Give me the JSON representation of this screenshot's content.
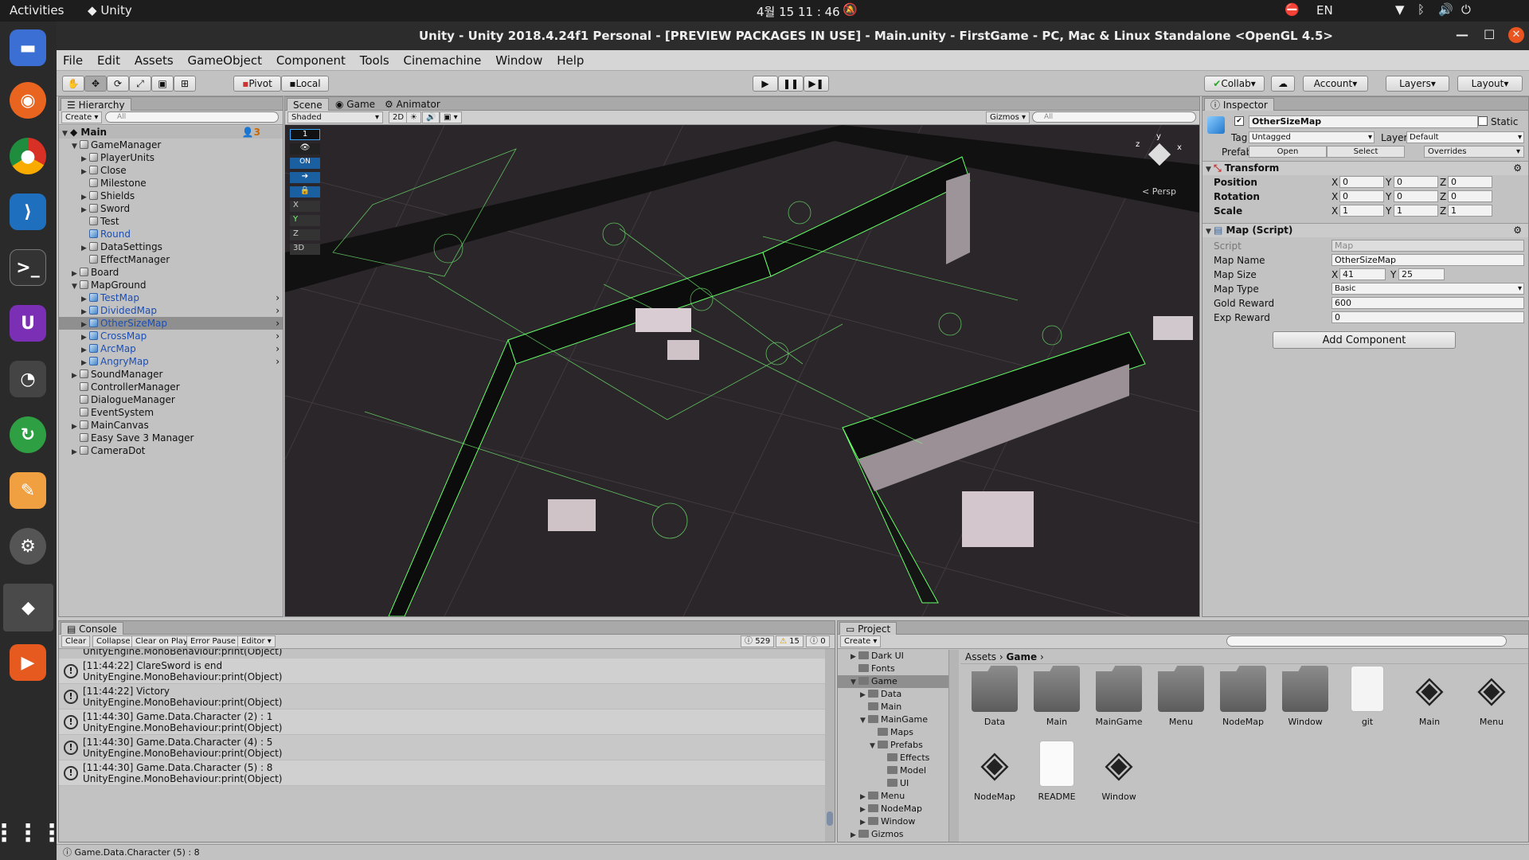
{
  "os": {
    "activities": "Activities",
    "app": "Unity",
    "clock": "4월 15  11 : 46",
    "lang": "EN"
  },
  "window": {
    "title": "Unity - Unity 2018.4.24f1 Personal - [PREVIEW PACKAGES IN USE] - Main.unity - FirstGame - PC, Mac & Linux Standalone <OpenGL 4.5>"
  },
  "menu": [
    "File",
    "Edit",
    "Assets",
    "GameObject",
    "Component",
    "Tools",
    "Cinemachine",
    "Window",
    "Help"
  ],
  "toolbar": {
    "pivot": "Pivot",
    "local": "Local",
    "collab": "Collab",
    "account": "Account",
    "layers": "Layers",
    "layout": "Layout"
  },
  "hierarchy": {
    "tab": "Hierarchy",
    "create": "Create",
    "search": "All",
    "scene": "Main",
    "badge": "3",
    "rows": [
      {
        "label": "GameManager",
        "indent": 1,
        "arrow": "▼",
        "blue": false
      },
      {
        "label": "PlayerUnits",
        "indent": 2,
        "arrow": "▶",
        "blue": false
      },
      {
        "label": "Close",
        "indent": 2,
        "arrow": "▶",
        "blue": false
      },
      {
        "label": "Milestone",
        "indent": 2,
        "arrow": "",
        "blue": false
      },
      {
        "label": "Shields",
        "indent": 2,
        "arrow": "▶",
        "blue": false
      },
      {
        "label": "Sword",
        "indent": 2,
        "arrow": "▶",
        "blue": false
      },
      {
        "label": "Test",
        "indent": 2,
        "arrow": "",
        "blue": false
      },
      {
        "label": "Round",
        "indent": 2,
        "arrow": "",
        "blue": true
      },
      {
        "label": "DataSettings",
        "indent": 2,
        "arrow": "▶",
        "blue": false
      },
      {
        "label": "EffectManager",
        "indent": 2,
        "arrow": "",
        "blue": false
      },
      {
        "label": "Board",
        "indent": 1,
        "arrow": "▶",
        "blue": false
      },
      {
        "label": "MapGround",
        "indent": 1,
        "arrow": "▼",
        "blue": false
      },
      {
        "label": "TestMap",
        "indent": 2,
        "arrow": "▶",
        "blue": true
      },
      {
        "label": "DividedMap",
        "indent": 2,
        "arrow": "▶",
        "blue": true
      },
      {
        "label": "OtherSizeMap",
        "indent": 2,
        "arrow": "▶",
        "blue": true,
        "selected": true
      },
      {
        "label": "CrossMap",
        "indent": 2,
        "arrow": "▶",
        "blue": true
      },
      {
        "label": "ArcMap",
        "indent": 2,
        "arrow": "▶",
        "blue": true
      },
      {
        "label": "AngryMap",
        "indent": 2,
        "arrow": "▶",
        "blue": true
      },
      {
        "label": "SoundManager",
        "indent": 1,
        "arrow": "▶",
        "blue": false
      },
      {
        "label": "ControllerManager",
        "indent": 1,
        "arrow": "",
        "blue": false
      },
      {
        "label": "DialogueManager",
        "indent": 1,
        "arrow": "",
        "blue": false
      },
      {
        "label": "EventSystem",
        "indent": 1,
        "arrow": "",
        "blue": false
      },
      {
        "label": "MainCanvas",
        "indent": 1,
        "arrow": "▶",
        "blue": false
      },
      {
        "label": "Easy Save 3 Manager",
        "indent": 1,
        "arrow": "",
        "blue": false
      },
      {
        "label": "CameraDot",
        "indent": 1,
        "arrow": "▶",
        "blue": false
      }
    ]
  },
  "scene": {
    "tabs": [
      "Scene",
      "Game",
      "Animator"
    ],
    "shading": "Shaded",
    "mode2d": "2D",
    "gizmos": "Gizmos",
    "search": "All",
    "persp": "< Persp",
    "badge1": "1",
    "on": "ON",
    "axes": [
      "X",
      "Y",
      "Z"
    ],
    "mode3d": "3D"
  },
  "inspector": {
    "tab": "Inspector",
    "name": "OtherSizeMap",
    "static": "Static",
    "tag_label": "Tag",
    "tag": "Untagged",
    "layer_label": "Layer",
    "layer": "Default",
    "prefab_label": "Prefab",
    "open": "Open",
    "select": "Select",
    "overrides": "Overrides",
    "transform": {
      "title": "Transform",
      "rows": [
        {
          "label": "Position",
          "x": "0",
          "y": "0",
          "z": "0"
        },
        {
          "label": "Rotation",
          "x": "0",
          "y": "0",
          "z": "0"
        },
        {
          "label": "Scale",
          "x": "1",
          "y": "1",
          "z": "1"
        }
      ]
    },
    "script": {
      "title": "Map (Script)",
      "script_label": "Script",
      "script": "Map",
      "map_name_label": "Map Name",
      "map_name": "OtherSizeMap",
      "map_size_label": "Map Size",
      "size_x": "41",
      "size_y": "25",
      "map_type_label": "Map Type",
      "map_type": "Basic",
      "gold_label": "Gold Reward",
      "gold": "600",
      "exp_label": "Exp Reward",
      "exp": "0"
    },
    "add_component": "Add Component"
  },
  "console": {
    "tab": "Console",
    "buttons": [
      "Clear",
      "Collapse",
      "Clear on Play",
      "Error Pause",
      "Editor"
    ],
    "count_info": "529",
    "count_warn": "15",
    "count_err": "0",
    "partial": "UnityEngine.MonoBehaviour:print(Object)",
    "entries": [
      {
        "msg": "[11:44:22] ClareSword is end",
        "src": "UnityEngine.MonoBehaviour:print(Object)"
      },
      {
        "msg": "[11:44:22] Victory",
        "src": "UnityEngine.MonoBehaviour:print(Object)"
      },
      {
        "msg": "[11:44:30] Game.Data.Character (2) : 1",
        "src": "UnityEngine.MonoBehaviour:print(Object)"
      },
      {
        "msg": "[11:44:30] Game.Data.Character (4) : 5",
        "src": "UnityEngine.MonoBehaviour:print(Object)"
      },
      {
        "msg": "[11:44:30] Game.Data.Character (5) : 8",
        "src": "UnityEngine.MonoBehaviour:print(Object)"
      }
    ]
  },
  "project": {
    "tab": "Project",
    "create": "Create",
    "breadcrumb": [
      "Assets",
      "Game"
    ],
    "tree": [
      {
        "label": "Dark UI",
        "indent": 1,
        "arrow": "▶"
      },
      {
        "label": "Fonts",
        "indent": 1,
        "arrow": ""
      },
      {
        "label": "Game",
        "indent": 1,
        "arrow": "▼",
        "selected": true
      },
      {
        "label": "Data",
        "indent": 2,
        "arrow": "▶"
      },
      {
        "label": "Main",
        "indent": 2,
        "arrow": ""
      },
      {
        "label": "MainGame",
        "indent": 2,
        "arrow": "▼"
      },
      {
        "label": "Maps",
        "indent": 3,
        "arrow": ""
      },
      {
        "label": "Prefabs",
        "indent": 3,
        "arrow": "▼"
      },
      {
        "label": "Effects",
        "indent": 4,
        "arrow": ""
      },
      {
        "label": "Model",
        "indent": 4,
        "arrow": ""
      },
      {
        "label": "UI",
        "indent": 4,
        "arrow": ""
      },
      {
        "label": "Menu",
        "indent": 2,
        "arrow": "▶"
      },
      {
        "label": "NodeMap",
        "indent": 2,
        "arrow": "▶"
      },
      {
        "label": "Window",
        "indent": 2,
        "arrow": "▶"
      },
      {
        "label": "Gizmos",
        "indent": 1,
        "arrow": "▶"
      }
    ],
    "assets": [
      {
        "label": "Data",
        "kind": "folder"
      },
      {
        "label": "Main",
        "kind": "folder"
      },
      {
        "label": "MainGame",
        "kind": "folder"
      },
      {
        "label": "Menu",
        "kind": "folder"
      },
      {
        "label": "NodeMap",
        "kind": "folder"
      },
      {
        "label": "Window",
        "kind": "folder"
      },
      {
        "label": "git",
        "kind": "file"
      },
      {
        "label": "Main",
        "kind": "unity"
      },
      {
        "label": "Menu",
        "kind": "unity"
      },
      {
        "label": "NodeMap",
        "kind": "unity"
      },
      {
        "label": "README",
        "kind": "doc"
      },
      {
        "label": "Window",
        "kind": "unity"
      }
    ]
  },
  "statusbar": {
    "text": "Game.Data.Character (5) : 8"
  }
}
